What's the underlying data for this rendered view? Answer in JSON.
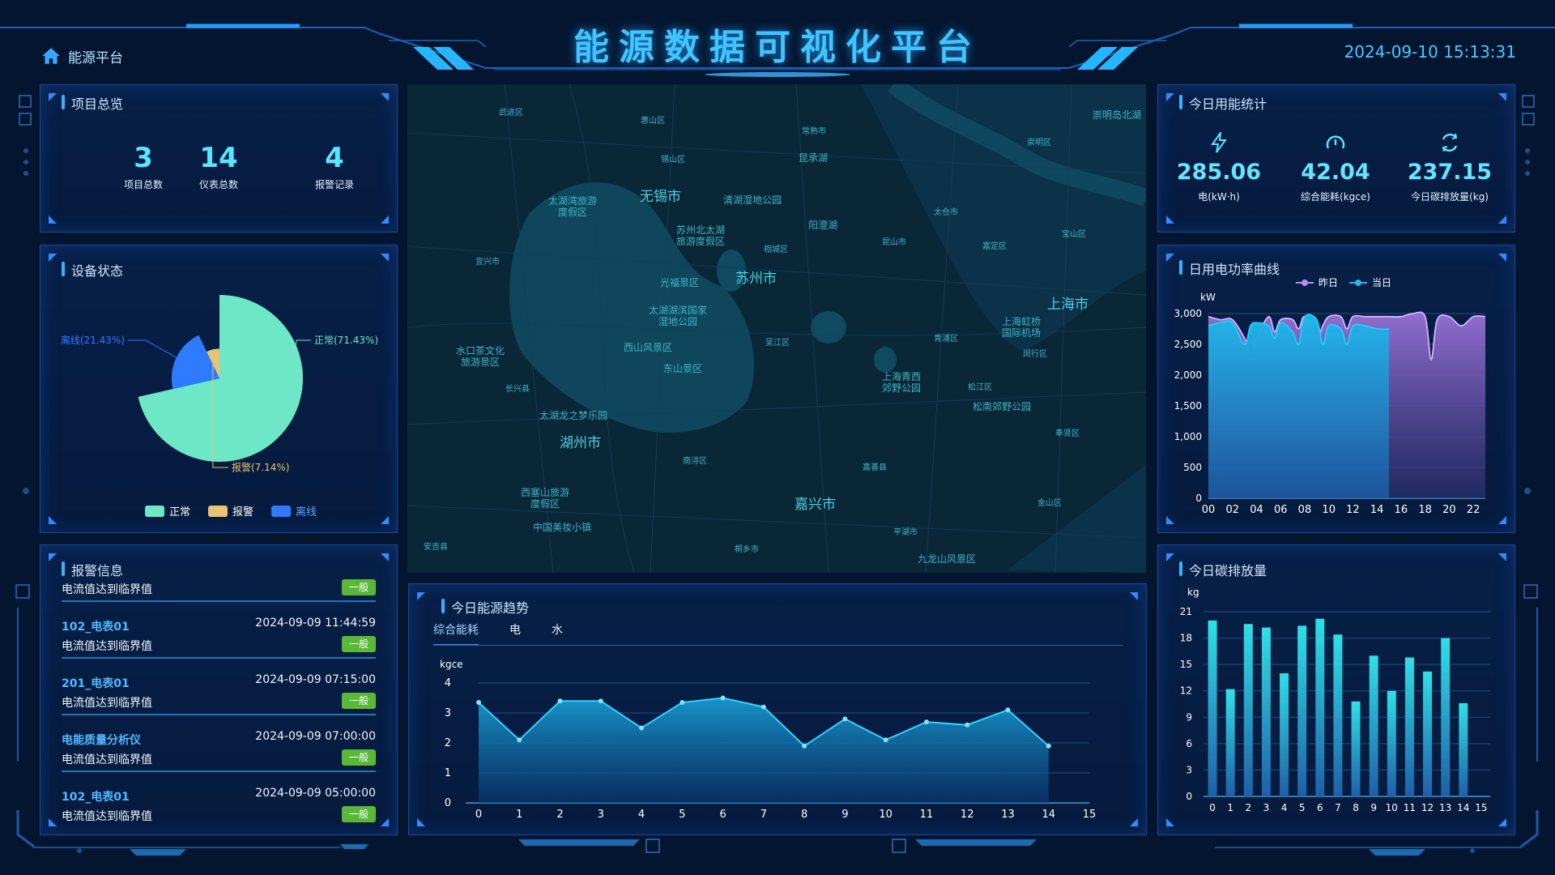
{
  "header": {
    "title": "能源数据可视化平台",
    "home_label": "能源平台",
    "datetime": "2024-09-10 15:13:31"
  },
  "overview": {
    "title": "项目总览",
    "stats": [
      {
        "value": "3",
        "label": "项目总数"
      },
      {
        "value": "14",
        "label": "仪表总数"
      },
      {
        "value": "4",
        "label": "报警记录"
      }
    ]
  },
  "device_status": {
    "title": "设备状态",
    "labels": [
      "正常(71.43%)",
      "离线(21.43%)",
      "报警(7.14%)"
    ],
    "legend": [
      {
        "name": "正常",
        "color": "#6ee7c6"
      },
      {
        "name": "报警",
        "color": "#e6c472"
      },
      {
        "name": "离线",
        "color": "#2f7bff"
      }
    ]
  },
  "alarms": {
    "title": "报警信息",
    "items": [
      {
        "device": "",
        "time": "",
        "message": "电流值达到临界值",
        "level": "一般"
      },
      {
        "device": "102_电表01",
        "time": "2024-09-09 11:44:59",
        "message": "电流值达到临界值",
        "level": "一般"
      },
      {
        "device": "201_电表01",
        "time": "2024-09-09 07:15:00",
        "message": "电流值达到临界值",
        "level": "一般"
      },
      {
        "device": "电能质量分析仪",
        "time": "2024-09-09 07:00:00",
        "message": "电流值达到临界值",
        "level": "一般"
      },
      {
        "device": "102_电表01",
        "time": "2024-09-09 05:00:00",
        "message": "电流值达到临界值",
        "level": "一般"
      }
    ]
  },
  "map": {
    "labels": {
      "wuxi": "无锡市",
      "suzhou": "苏州市",
      "shanghai": "上海市",
      "huzhou": "湖州市",
      "jiaxing": "嘉兴市",
      "taihu_wan": "太湖湾旅游度假区",
      "wetland": "清湖湿地公园",
      "beitaihu": "苏州北太湖旅游度假区",
      "yangcheng": "阳澄湖",
      "guangfu": "光福景区",
      "taihu_hu": "太湖湖滨国家湿地公园",
      "xishan": "西山风景区",
      "dongshan": "东山景区",
      "shuikou": "水口茶文化旅游景区",
      "taihu_long": "太湖龙之梦乐园",
      "hongqiao": "上海虹桥国际机场",
      "qingxi": "上海青西郊野公园",
      "songnan": "松南郊野公园",
      "xisai": "西塞山旅游度假区",
      "meigu": "中国美妆小镇",
      "jiulong": "九龙山风景区",
      "chongming": "崇明岛北湖",
      "d_wujin": "武进区",
      "d_huishan": "惠山区",
      "d_xishan": "锡山区",
      "d_changshu": "常熟市",
      "d_kunchenghu": "昆承湖",
      "d_taicang": "太仓市",
      "d_kunshan": "昆山市",
      "d_xiangcheng": "相城区",
      "d_yixing": "宜兴市",
      "d_wujiang": "吴江区",
      "d_qingpu": "青浦区",
      "d_minhang": "闵行区",
      "d_songjiang": "松江区",
      "d_fengxian": "奉贤区",
      "d_jiading": "嘉定区",
      "d_baoshan": "宝山区",
      "d_changxing": "长兴县",
      "d_nanxun": "南浔区",
      "d_jiashan": "嘉善县",
      "d_jinshan": "金山区",
      "d_pinghu": "平湖市",
      "d_tongxiang": "桐乡市",
      "d_anji": "安吉县",
      "d_chongming": "崇明区"
    }
  },
  "energy_trend": {
    "title": "今日能源趋势",
    "tabs": [
      "综合能耗",
      "电",
      "水"
    ]
  },
  "today_stats": {
    "title": "今日用能统计",
    "items": [
      {
        "value": "285.06",
        "label": "电(kW·h)",
        "icon": "lightning-icon"
      },
      {
        "value": "42.04",
        "label": "综合能耗(kgce)",
        "icon": "gauge-icon"
      },
      {
        "value": "237.15",
        "label": "今日碳排放量(kg)",
        "icon": "recycle-icon"
      }
    ]
  },
  "power_curve": {
    "title": "日用电功率曲线"
  },
  "carbon": {
    "title": "今日碳排放量"
  },
  "chart_data": [
    {
      "type": "pie",
      "id": "device_status",
      "categories": [
        "正常",
        "离线",
        "报警"
      ],
      "values": [
        71.43,
        21.43,
        7.14
      ],
      "rose": true,
      "colors": [
        "#6ee7c6",
        "#2f7bff",
        "#e6c472"
      ]
    },
    {
      "type": "area",
      "id": "energy_trend",
      "ylabel": "kgce",
      "x": [
        0,
        1,
        2,
        3,
        4,
        5,
        6,
        7,
        8,
        9,
        10,
        11,
        12,
        13,
        14
      ],
      "xticks": [
        0,
        1,
        2,
        3,
        4,
        5,
        6,
        7,
        8,
        9,
        10,
        11,
        12,
        13,
        14,
        15
      ],
      "values": [
        3.35,
        2.1,
        3.4,
        3.4,
        2.5,
        3.35,
        3.5,
        3.2,
        1.9,
        2.8,
        2.1,
        2.7,
        2.6,
        3.1,
        1.9
      ],
      "ylim": [
        0,
        4
      ],
      "yticks": [
        0,
        1,
        2,
        3,
        4
      ]
    },
    {
      "type": "area",
      "id": "power_curve",
      "ylabel": "kW",
      "xticks": [
        "00",
        "02",
        "04",
        "06",
        "08",
        "10",
        "12",
        "14",
        "16",
        "18",
        "20",
        "22"
      ],
      "ylim": [
        0,
        3000
      ],
      "yticks": [
        0,
        500,
        1000,
        1500,
        2000,
        2500,
        3000
      ],
      "series": [
        {
          "name": "昨日",
          "color": "#b48ef0",
          "x": [
            0,
            1,
            2,
            3,
            3.5,
            4,
            5,
            5.5,
            6,
            7,
            7.5,
            8,
            9,
            9.5,
            10,
            11,
            11.5,
            12,
            13,
            14,
            15,
            16,
            17,
            18,
            18.5,
            19,
            20,
            21,
            22,
            23
          ],
          "values": [
            2950,
            2900,
            2900,
            2600,
            2350,
            2600,
            2950,
            2700,
            2900,
            2900,
            2750,
            2950,
            2600,
            2800,
            2950,
            2950,
            2750,
            2950,
            2950,
            2950,
            2950,
            2950,
            3000,
            2950,
            2250,
            2900,
            2950,
            2800,
            2950,
            2950
          ]
        },
        {
          "name": "当日",
          "color": "#26b8e6",
          "x": [
            0,
            1,
            2,
            3,
            3.5,
            4,
            5,
            5.5,
            6,
            7,
            7.5,
            8,
            9,
            9.5,
            10,
            11,
            11.5,
            12,
            13,
            14,
            15
          ],
          "values": [
            2800,
            2850,
            2850,
            2500,
            2800,
            2850,
            2800,
            2600,
            2850,
            2700,
            2500,
            2950,
            2900,
            2500,
            2800,
            2750,
            2500,
            2800,
            2800,
            2750,
            2750
          ]
        }
      ]
    },
    {
      "type": "bar",
      "id": "carbon",
      "ylabel": "kg",
      "categories": [
        "0",
        "1",
        "2",
        "3",
        "4",
        "5",
        "6",
        "7",
        "8",
        "9",
        "10",
        "11",
        "12",
        "13",
        "14",
        "15"
      ],
      "values": [
        20,
        12.2,
        19.6,
        19.2,
        14,
        19.4,
        20.2,
        18.4,
        10.8,
        16,
        12,
        15.8,
        14.2,
        18,
        10.6,
        null
      ],
      "ylim": [
        0,
        21
      ],
      "yticks": [
        0,
        3,
        6,
        9,
        12,
        15,
        18,
        21
      ]
    }
  ]
}
